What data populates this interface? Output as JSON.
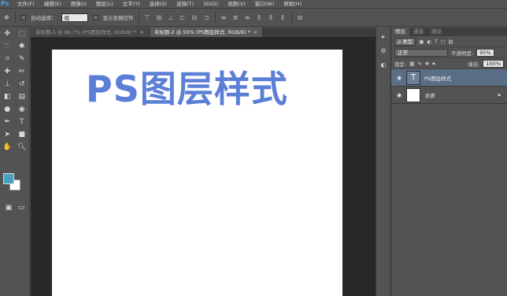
{
  "app": {
    "logo": "Ps"
  },
  "menu": [
    "文件(F)",
    "编辑(E)",
    "图像(I)",
    "图层(L)",
    "文字(Y)",
    "选择(S)",
    "滤镜(T)",
    "3D(D)",
    "视图(V)",
    "窗口(W)",
    "帮助(H)"
  ],
  "options": {
    "auto_select_label": "自动选择：",
    "auto_select_value": "组",
    "show_transform_label": "显示变换控件"
  },
  "tabs": [
    {
      "label": "未标题-1 @ 66.7% (PS图层样式, RGB/8) *",
      "close": "×"
    },
    {
      "label": "未标题-2 @ 50% (PS图层样式, RGB/8) *",
      "close": "×"
    }
  ],
  "canvas": {
    "text": "PS图层样式",
    "text_color": "#5b7fd6"
  },
  "layers_panel": {
    "tabs": [
      "图层",
      "通道",
      "路径"
    ],
    "filter_label": "ρ 类型",
    "blend_mode": "正常",
    "opacity_label": "不透明度:",
    "opacity_value": "95%",
    "lock_label": "锁定:",
    "fill_label": "填充:",
    "fill_value": "100%",
    "layers": [
      {
        "name": "PS图层样式",
        "thumb": "T"
      },
      {
        "name": "背景"
      }
    ]
  },
  "colors": {
    "foreground": "#4aa0c0",
    "background": "#ffffff"
  }
}
